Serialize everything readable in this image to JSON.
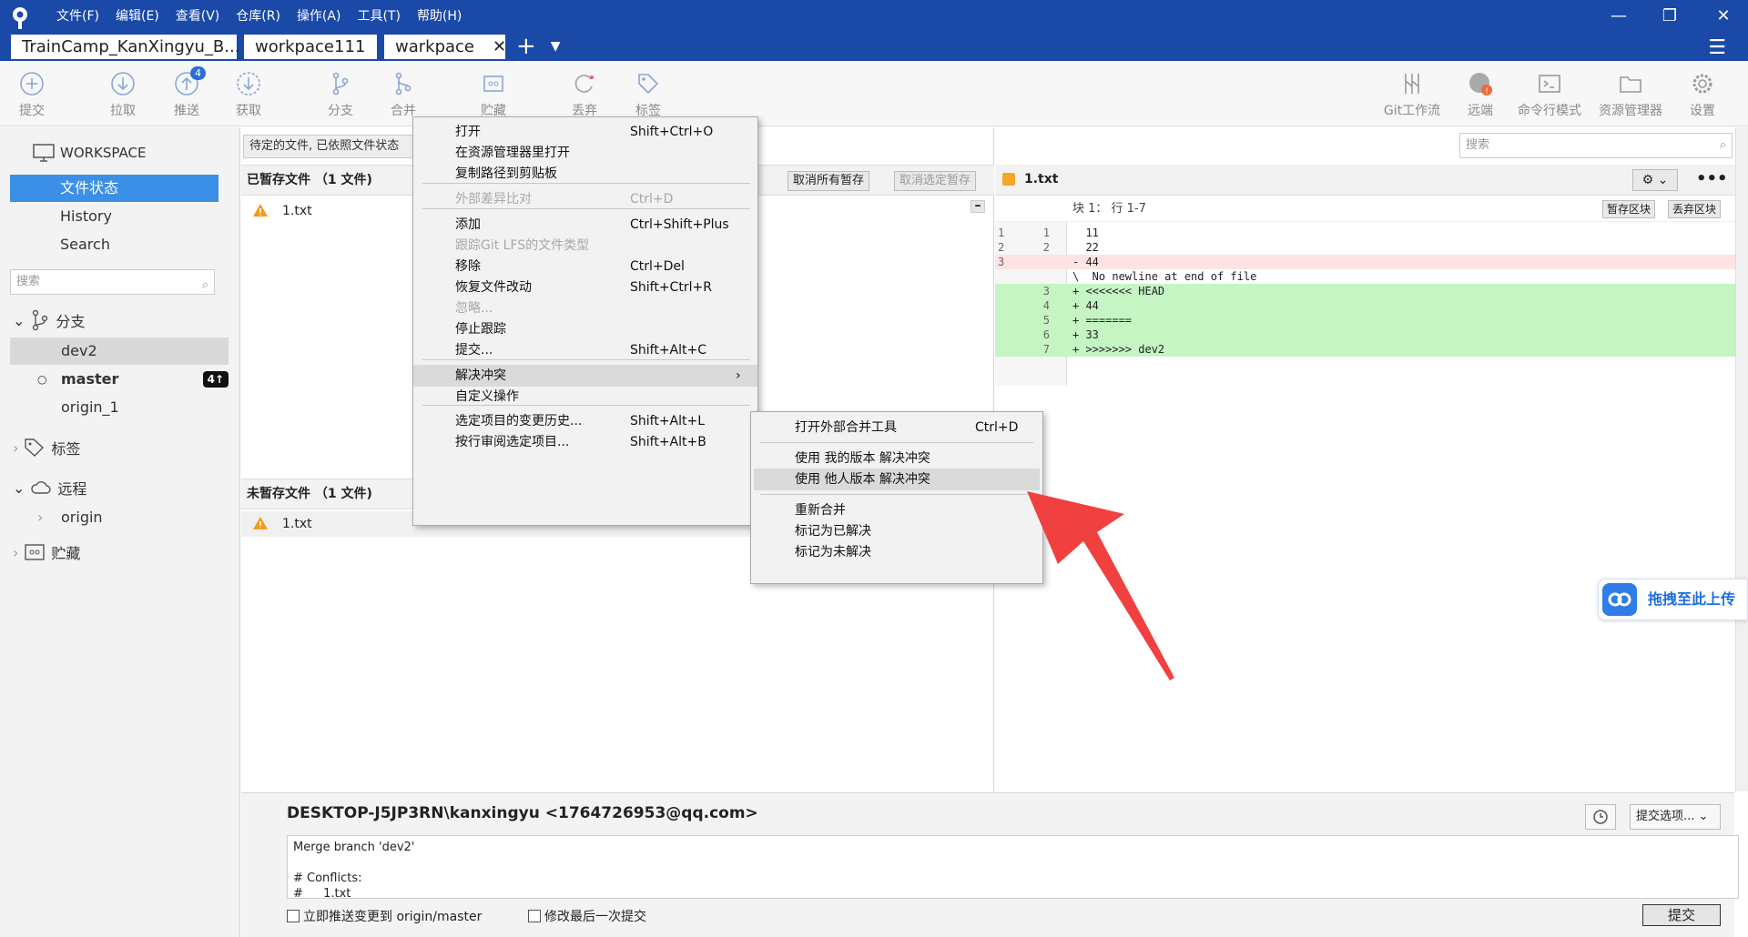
{
  "menubar": [
    "文件(F)",
    "编辑(E)",
    "查看(V)",
    "仓库(R)",
    "操作(A)",
    "工具(T)",
    "帮助(H)"
  ],
  "tabs": [
    "TrainCamp_KanXingyu_B...",
    "workpace111",
    "warkpace"
  ],
  "window": {
    "minimize": "—",
    "restore": "❐",
    "close": "✕",
    "menu": "☰"
  },
  "toolbar": {
    "commit": "提交",
    "pull": "拉取",
    "push": "推送",
    "push_badge": "4",
    "fetch": "获取",
    "branch": "分支",
    "merge": "合并",
    "stash": "贮藏",
    "discard": "丢弃",
    "tag": "标签",
    "gitflow": "Git工作流",
    "remote": "远端",
    "terminal": "命令行模式",
    "explorer": "资源管理器",
    "settings": "设置"
  },
  "sidebar": {
    "workspace": "WORKSPACE",
    "items": [
      "文件状态",
      "History",
      "Search"
    ],
    "search_placeholder": "搜索",
    "branches_label": "分支",
    "branches": [
      "dev2",
      "master",
      "origin_1"
    ],
    "master_badge": "4↑",
    "tags_label": "标签",
    "remote_label": "远程",
    "remotes": [
      "origin"
    ],
    "stash_label": "贮藏"
  },
  "center": {
    "pending": "待定的文件, 已依照文件状态",
    "staged_title": "已暂存文件 （1 文件)",
    "unstage_all": "取消所有暂存",
    "unstage_selected": "取消选定暂存",
    "staged_files": [
      "1.txt"
    ],
    "unstaged_title": "未暂存文件 （1 文件)",
    "unstaged_files": [
      "1.txt"
    ]
  },
  "diff": {
    "search_placeholder": "搜索",
    "file": "1.txt",
    "hunk": "块 1： 行 1-7",
    "stage_hunk": "暂存区块",
    "discard_hunk": "丢弃区块",
    "lines": [
      {
        "n1": "1",
        "n2": "1",
        "text": "  11",
        "kind": "ctx"
      },
      {
        "n1": "2",
        "n2": "2",
        "text": "  22",
        "kind": "ctx"
      },
      {
        "n1": "3",
        "n2": "",
        "text": "- 44",
        "kind": "del"
      },
      {
        "n1": "",
        "n2": "",
        "text": "\\  No newline at end of file",
        "kind": "ctx"
      },
      {
        "n1": "",
        "n2": "3",
        "text": "+ <<<<<<< HEAD",
        "kind": "add"
      },
      {
        "n1": "",
        "n2": "4",
        "text": "+ 44",
        "kind": "add"
      },
      {
        "n1": "",
        "n2": "5",
        "text": "+ =======",
        "kind": "add"
      },
      {
        "n1": "",
        "n2": "6",
        "text": "+ 33",
        "kind": "add"
      },
      {
        "n1": "",
        "n2": "7",
        "text": "+ >>>>>>> dev2",
        "kind": "add"
      }
    ]
  },
  "commit": {
    "author": "DESKTOP-J5JP3RN\\kanxingyu <1764726953@qq.com>",
    "options": "提交选项...",
    "message": "Merge branch 'dev2'\n\n# Conflicts:\n#\t1.txt",
    "push_now": "立即推送变更到 origin/master",
    "amend": "修改最后一次提交",
    "submit": "提交"
  },
  "context_menu": [
    {
      "label": "打开",
      "shortcut": "Shift+Ctrl+O"
    },
    {
      "label": "在资源管理器里打开",
      "shortcut": ""
    },
    {
      "label": "复制路径到剪贴板",
      "shortcut": ""
    },
    {
      "label": "外部差异比对",
      "shortcut": "Ctrl+D",
      "disabled": true
    },
    {
      "label": "添加",
      "shortcut": "Ctrl+Shift+Plus"
    },
    {
      "label": "跟踪Git LFS的文件类型",
      "shortcut": "",
      "disabled": true
    },
    {
      "label": "移除",
      "shortcut": "Ctrl+Del"
    },
    {
      "label": "恢复文件改动",
      "shortcut": "Shift+Ctrl+R"
    },
    {
      "label": "忽略...",
      "shortcut": "",
      "disabled": true
    },
    {
      "label": "停止跟踪",
      "shortcut": ""
    },
    {
      "label": "提交...",
      "shortcut": "Shift+Alt+C"
    },
    {
      "label": "解决冲突",
      "shortcut": "",
      "submenu": true
    },
    {
      "label": "自定义操作",
      "shortcut": ""
    },
    {
      "label": "选定项目的变更历史...",
      "shortcut": "Shift+Alt+L"
    },
    {
      "label": "按行审阅选定项目...",
      "shortcut": "Shift+Alt+B"
    }
  ],
  "submenu": [
    {
      "label": "打开外部合并工具",
      "shortcut": "Ctrl+D"
    },
    {
      "label": "使用 我的版本 解决冲突",
      "shortcut": ""
    },
    {
      "label": "使用 他人版本 解决冲突",
      "shortcut": ""
    },
    {
      "label": "重新合并",
      "shortcut": ""
    },
    {
      "label": "标记为已解决",
      "shortcut": ""
    },
    {
      "label": "标记为未解决",
      "shortcut": ""
    }
  ],
  "upload_widget": "拖拽至此上传",
  "colors": {
    "titlebar": "#1a49a8",
    "selection": "#3b8fe6",
    "arrow": "#f04040",
    "add_line": "#c5f5c2",
    "del_line": "#ffe3e3"
  }
}
